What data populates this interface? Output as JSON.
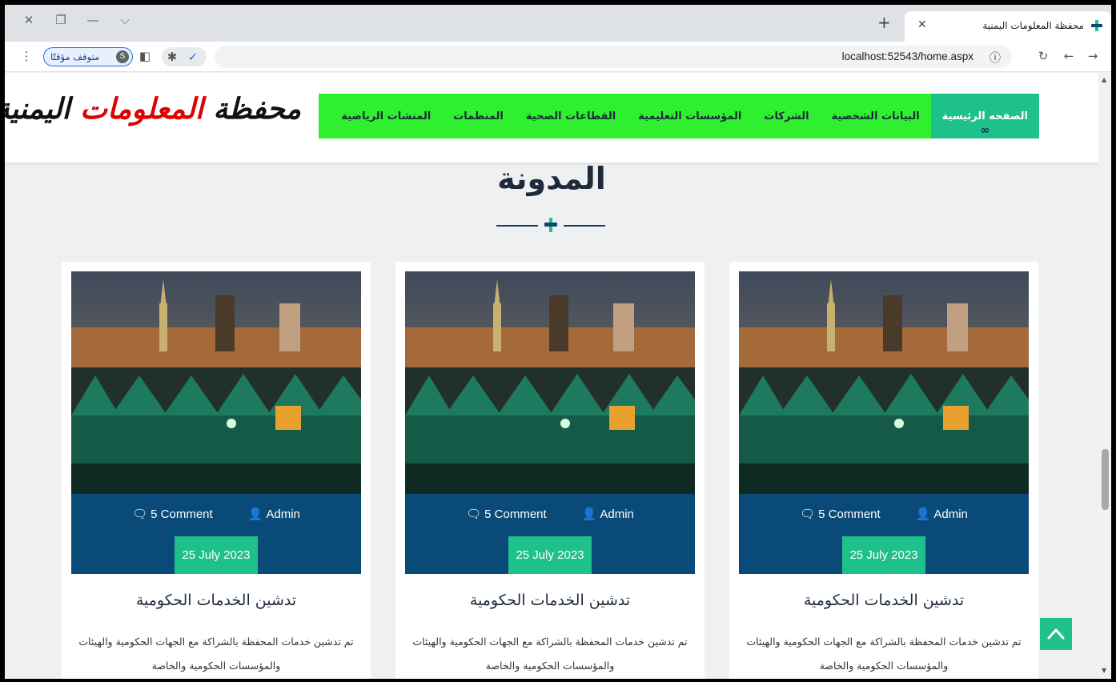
{
  "browser": {
    "tab_title": "محفظة المعلومات اليمنية",
    "url": "localhost:52543/home.aspx",
    "profile_paused_label": "متوقف مؤقتًا",
    "profile_initial": "S"
  },
  "site": {
    "logo": {
      "part1": "محفظة ",
      "part2": "المعلومات",
      "part3": " اليمنية"
    },
    "nav": [
      {
        "label": "الصفحه الرئيسية",
        "active": true
      },
      {
        "label": "البيانات الشخصية"
      },
      {
        "label": "الشركات"
      },
      {
        "label": "المؤسسات التعليمية"
      },
      {
        "label": "القطاعات الصحية"
      },
      {
        "label": "المنظمات"
      },
      {
        "label": "المنشات الرياضية"
      }
    ],
    "section_title": "المدونة"
  },
  "cards": [
    {
      "comments": "5 Comment",
      "author": "Admin",
      "date": "25 July 2023",
      "title": "تدشين الخدمات الحكومية",
      "text": "تم تدشين خدمات المحفظة بالشراكة مع الجهات الحكومية والهيئات والمؤسسات الحكومية والخاصة"
    },
    {
      "comments": "5 Comment",
      "author": "Admin",
      "date": "25 July 2023",
      "title": "تدشين الخدمات الحكومية",
      "text": "تم تدشين خدمات المحفظة بالشراكة مع الجهات الحكومية والهيئات والمؤسسات الحكومية والخاصة"
    },
    {
      "comments": "5 Comment",
      "author": "Admin",
      "date": "25 July 2023",
      "title": "تدشين الخدمات الحكومية",
      "text": "تم تدشين خدمات المحفظة بالشراكة مع الجهات الحكومية والهيئات والمؤسسات الحكومية والخاصة"
    }
  ],
  "colors": {
    "nav_bg": "#2ef02e",
    "accent": "#1ec08c",
    "meta_bg": "#0a4a78"
  },
  "icons": {
    "comment": "comment-icon",
    "user": "user-icon",
    "scroll_top": "chevron-up-icon"
  }
}
